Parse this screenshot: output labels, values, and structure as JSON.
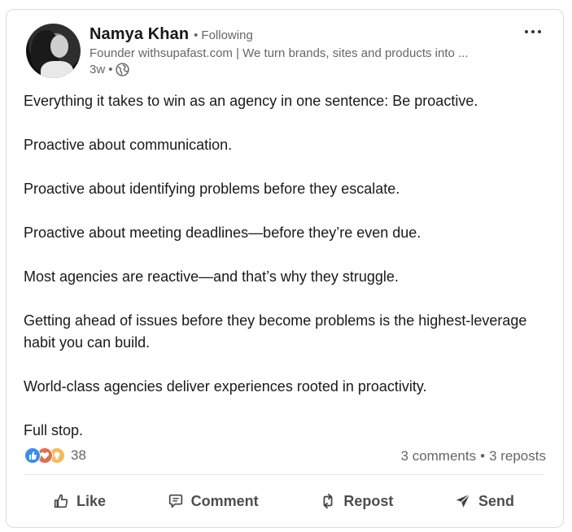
{
  "author": {
    "name": "Namya Khan",
    "follow_status": "Following",
    "headline": "Founder withsupafast.com | We turn brands, sites and products into ...",
    "posted_ago": "3w"
  },
  "post": {
    "paragraphs": [
      "Everything it takes to win as an agency in one sentence: Be proactive.",
      "Proactive about communication.",
      "Proactive about identifying problems before they escalate.",
      "Proactive about meeting deadlines—before they’re even due.",
      "Most agencies are reactive—and that’s why they struggle.",
      "Getting ahead of issues before they become problems is the highest-leverage habit you can build.",
      "World-class agencies deliver experiences rooted in proactivity.",
      "Full stop."
    ]
  },
  "social": {
    "reaction_count": "38",
    "comments": "3 comments",
    "reposts": "3 reposts",
    "reaction_icons": [
      "like-icon",
      "love-icon",
      "insightful-icon"
    ]
  },
  "actions": {
    "like": "Like",
    "comment": "Comment",
    "repost": "Repost",
    "send": "Send"
  },
  "colors": {
    "like_blue": "#378fe9",
    "love_red": "#df704d",
    "insight_yellow": "#f5bb5c",
    "secondary_text": "#666666"
  }
}
